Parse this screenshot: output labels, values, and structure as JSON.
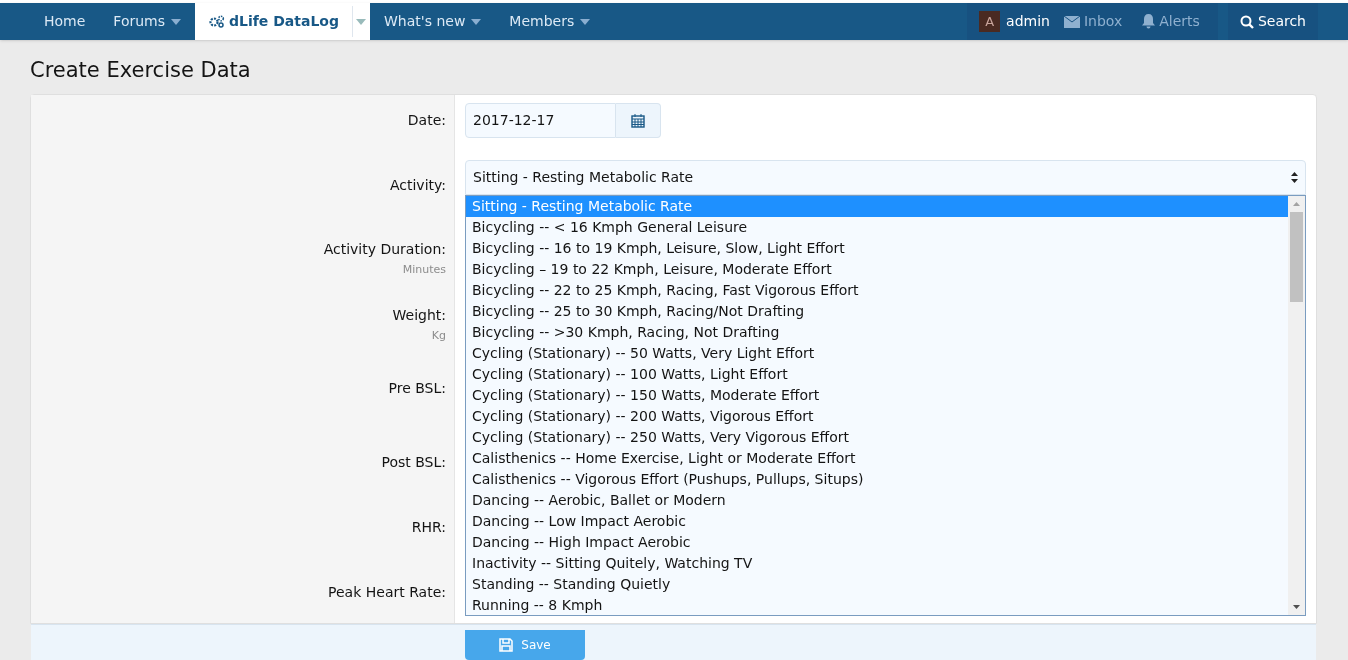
{
  "nav": {
    "items": [
      {
        "label": "Home",
        "dropdown": false,
        "selected": false,
        "kind": "link"
      },
      {
        "label": "Forums",
        "dropdown": true,
        "selected": false,
        "kind": "link"
      },
      {
        "label": "dLife DataLog",
        "dropdown": true,
        "selected": true,
        "kind": "app"
      },
      {
        "label": "What's new",
        "dropdown": true,
        "selected": false,
        "kind": "link"
      },
      {
        "label": "Members",
        "dropdown": true,
        "selected": false,
        "kind": "link"
      }
    ],
    "user": {
      "avatar_letter": "A",
      "name": "admin"
    },
    "inbox": "Inbox",
    "alerts": "Alerts",
    "search": "Search"
  },
  "page_title": "Create Exercise Data",
  "form": {
    "rows": [
      {
        "label": "Date:",
        "kind": "date",
        "value": "2017-12-17"
      },
      {
        "label": "Activity:",
        "kind": "select",
        "value": "Sitting - Resting Metabolic Rate"
      },
      {
        "label": "Activity Duration:",
        "hint": "Minutes",
        "kind": "hidden"
      },
      {
        "label": "Weight:",
        "hint": "Kg",
        "kind": "hidden"
      },
      {
        "label": "Pre BSL:",
        "kind": "hidden"
      },
      {
        "label": "Post BSL:",
        "kind": "hidden"
      },
      {
        "label": "RHR:",
        "kind": "hidden"
      },
      {
        "label": "Peak Heart Rate:",
        "kind": "hidden"
      }
    ],
    "dropdown_options": [
      {
        "label": "Sitting - Resting Metabolic Rate",
        "selected": true
      },
      {
        "label": "Bicycling -- < 16 Kmph General Leisure",
        "selected": false
      },
      {
        "label": "Bicycling -- 16 to 19 Kmph, Leisure, Slow, Light Effort",
        "selected": false
      },
      {
        "label": "Bicycling – 19 to 22 Kmph, Leisure, Moderate Effort",
        "selected": false
      },
      {
        "label": "Bicycling -- 22 to 25 Kmph, Racing, Fast Vigorous Effort",
        "selected": false
      },
      {
        "label": "Bicycling -- 25 to 30 Kmph, Racing/Not Drafting",
        "selected": false
      },
      {
        "label": "Bicycling -- >30 Kmph, Racing, Not Drafting",
        "selected": false
      },
      {
        "label": "Cycling (Stationary) -- 50 Watts, Very Light Effort",
        "selected": false
      },
      {
        "label": "Cycling (Stationary) -- 100 Watts, Light Effort",
        "selected": false
      },
      {
        "label": "Cycling (Stationary) -- 150 Watts, Moderate Effort",
        "selected": false
      },
      {
        "label": "Cycling (Stationary) -- 200 Watts, Vigorous Effort",
        "selected": false
      },
      {
        "label": "Cycling (Stationary) -- 250 Watts, Very Vigorous Effort",
        "selected": false
      },
      {
        "label": "Calisthenics -- Home Exercise, Light or Moderate Effort",
        "selected": false
      },
      {
        "label": "Calisthenics -- Vigorous Effort (Pushups, Pullups, Situps)",
        "selected": false
      },
      {
        "label": "Dancing -- Aerobic, Ballet or Modern",
        "selected": false
      },
      {
        "label": "Dancing -- Low Impact Aerobic",
        "selected": false
      },
      {
        "label": "Dancing -- High Impact Aerobic",
        "selected": false
      },
      {
        "label": "Inactivity -- Sitting Quitely, Watching TV",
        "selected": false
      },
      {
        "label": "Standing -- Standing Quietly",
        "selected": false
      },
      {
        "label": "Running -- 8 Kmph",
        "selected": false
      }
    ],
    "save_button": "Save"
  }
}
